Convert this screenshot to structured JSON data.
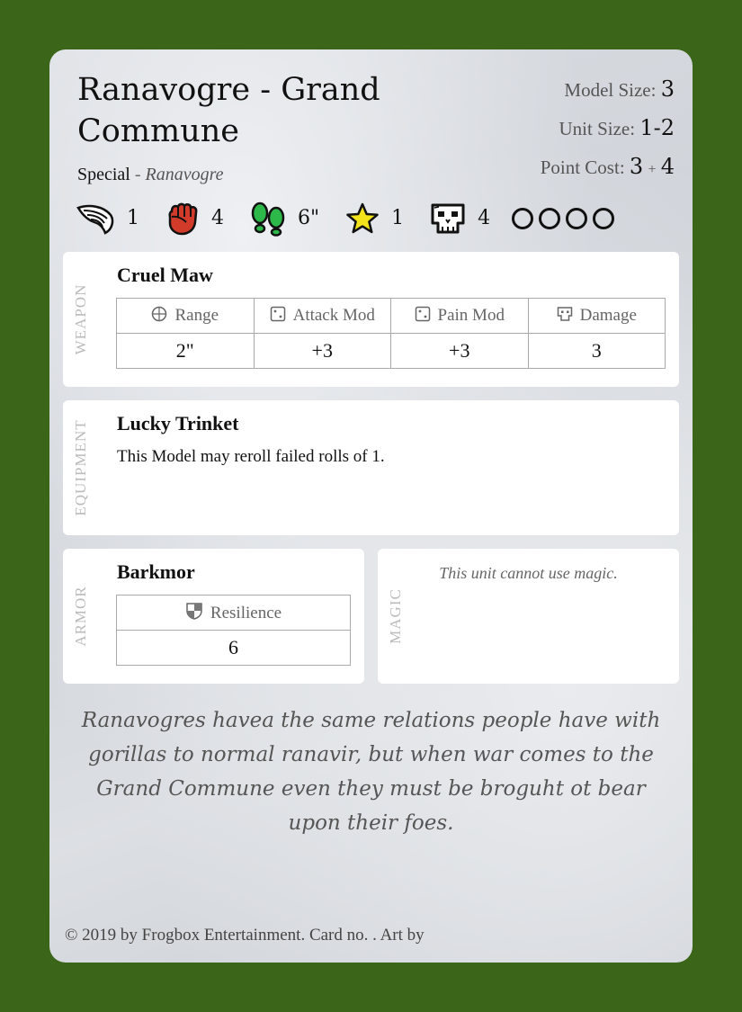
{
  "card": {
    "title": "Ranavogre - Grand Commune",
    "type": "Special",
    "type_separator": "-",
    "race": "Ranavogre"
  },
  "stats": {
    "model_size_label": "Model Size:",
    "model_size_value": "3",
    "unit_size_label": "Unit Size:",
    "unit_size_value": "1-2",
    "point_cost_label": "Point Cost:",
    "point_cost_base": "3",
    "point_cost_plus": "+",
    "point_cost_extra": "4"
  },
  "icon_stats": [
    {
      "icon": "wing-icon",
      "value": "1"
    },
    {
      "icon": "fist-icon",
      "value": "4"
    },
    {
      "icon": "footprints-icon",
      "value": "6\""
    },
    {
      "icon": "star-icon",
      "value": "1"
    },
    {
      "icon": "skull-icon",
      "value": "4"
    }
  ],
  "wound_circles": 4,
  "weapon": {
    "label": "WEAPON",
    "name": "Cruel Maw",
    "headers": [
      "Range",
      "Attack Mod",
      "Pain Mod",
      "Damage"
    ],
    "values": [
      "2\"",
      "+3",
      "+3",
      "3"
    ]
  },
  "equipment": {
    "label": "EQUIPMENT",
    "name": "Lucky Trinket",
    "description": "This Model may reroll failed rolls of 1."
  },
  "armor": {
    "label": "ARMOR",
    "name": "Barkmor",
    "header": "Resilience",
    "value": "6"
  },
  "magic": {
    "label": "MAGIC",
    "text": "This unit cannot use magic."
  },
  "flavor": "Ranavogres havea the same relations people have with gorillas to normal ranavir, but when war comes to the Grand Commune even they must be broguht ot bear upon their foes.",
  "footer": "© 2019 by Frogbox Entertainment. Card no. . Art by",
  "colors": {
    "background": "#3b6518",
    "fist": "#d23a2a",
    "footprints": "#2db84a",
    "star": "#f3e31a"
  }
}
